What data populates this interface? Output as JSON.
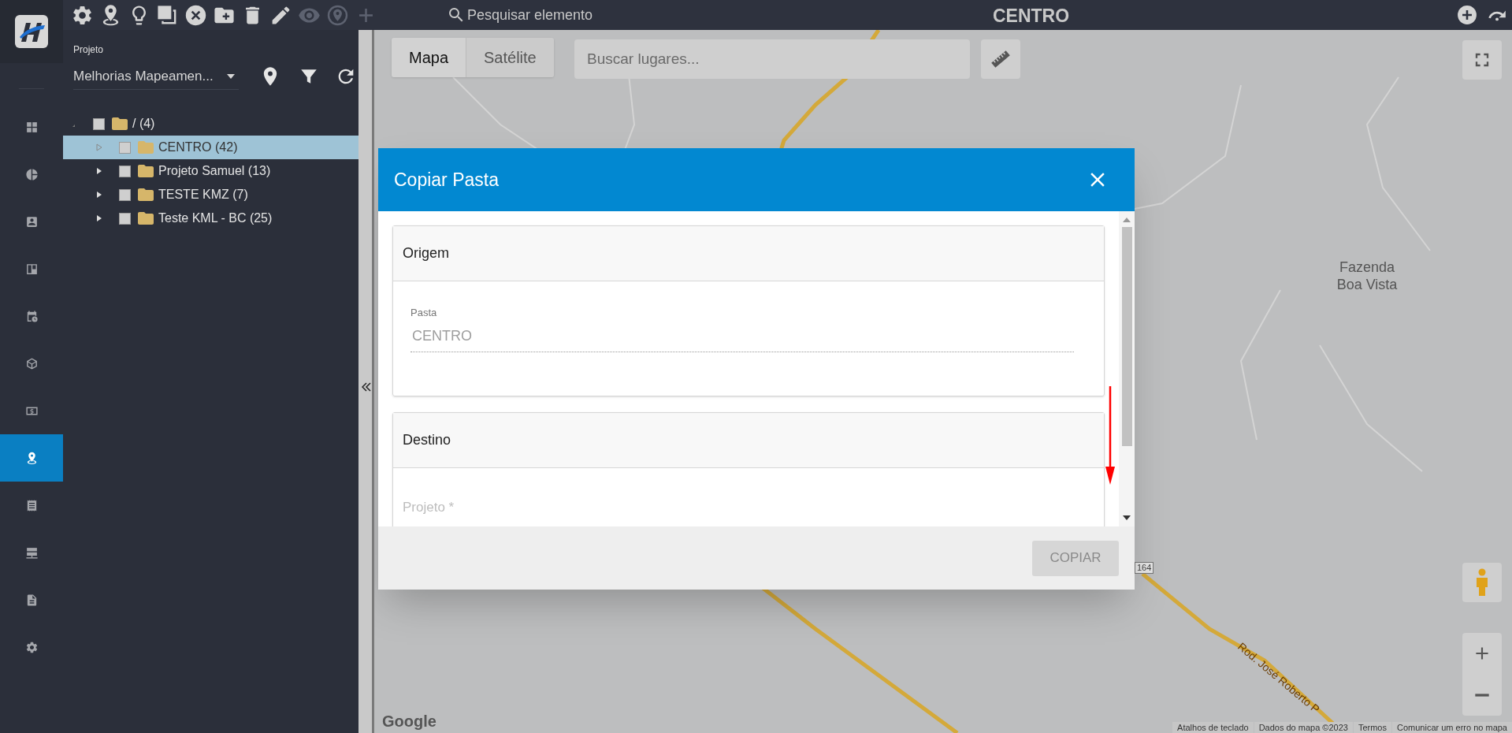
{
  "app": {
    "title": "CENTRO",
    "search_placeholder": "Pesquisar elemento"
  },
  "toolbar": [
    {
      "kind": "gear",
      "disabled": false
    },
    {
      "kind": "pin-base",
      "disabled": false
    },
    {
      "kind": "bulb",
      "disabled": false
    },
    {
      "kind": "copy",
      "disabled": false
    },
    {
      "kind": "cancel",
      "disabled": false
    },
    {
      "kind": "folder-add",
      "disabled": false
    },
    {
      "kind": "trash",
      "disabled": false
    },
    {
      "kind": "pencil",
      "disabled": false
    },
    {
      "kind": "eye",
      "disabled": true
    },
    {
      "kind": "pin-circle",
      "disabled": true
    },
    {
      "kind": "plus",
      "disabled": true
    }
  ],
  "top_actions": [
    {
      "kind": "add-circle"
    },
    {
      "kind": "redo"
    }
  ],
  "rail": [
    {
      "kind": "grid",
      "selected": false
    },
    {
      "kind": "pie",
      "selected": false
    },
    {
      "kind": "contact",
      "selected": false
    },
    {
      "kind": "board",
      "selected": false
    },
    {
      "kind": "calendar",
      "selected": false
    },
    {
      "kind": "box",
      "selected": false
    },
    {
      "kind": "money",
      "selected": false
    },
    {
      "kind": "pin-base",
      "selected": true
    },
    {
      "kind": "receipt",
      "selected": false
    },
    {
      "kind": "server",
      "selected": false
    },
    {
      "kind": "document",
      "selected": false
    },
    {
      "kind": "gear",
      "selected": false
    }
  ],
  "sidebar": {
    "project_label": "Projeto",
    "project_value": "Melhorias Mapeamen...",
    "tree": [
      {
        "label": "/ (4)",
        "expanded": true,
        "checked": false,
        "selected": false,
        "children": [
          {
            "label": "CENTRO (42)",
            "expanded": false,
            "checked": false,
            "selected": true
          },
          {
            "label": "Projeto Samuel (13)",
            "expanded": false,
            "checked": false,
            "selected": false
          },
          {
            "label": "TESTE KMZ (7)",
            "expanded": false,
            "checked": false,
            "selected": false
          },
          {
            "label": "Teste KML - BC (25)",
            "expanded": false,
            "checked": false,
            "selected": false
          }
        ]
      }
    ]
  },
  "map": {
    "map_types": [
      {
        "label": "Mapa",
        "selected": true
      },
      {
        "label": "Satélite",
        "selected": false
      }
    ],
    "search_placeholder": "Buscar lugares...",
    "place_label": "Fazenda Boa Vista",
    "road_label": "Rod. José Roberto P",
    "road_shield": "164",
    "logo": "Google",
    "attribution": [
      "Atalhos de teclado",
      "Dados do mapa ©2023",
      "Termos",
      "Comunicar um erro no mapa"
    ]
  },
  "dialog": {
    "title": "Copiar Pasta",
    "sections": [
      {
        "title": "Origem",
        "field": {
          "kind": "readonly",
          "label": "Pasta",
          "value": "CENTRO"
        }
      },
      {
        "title": "Destino",
        "field": {
          "kind": "select",
          "placeholder": "Projeto *"
        }
      }
    ],
    "button": {
      "label": "COPIAR",
      "disabled": true
    }
  }
}
